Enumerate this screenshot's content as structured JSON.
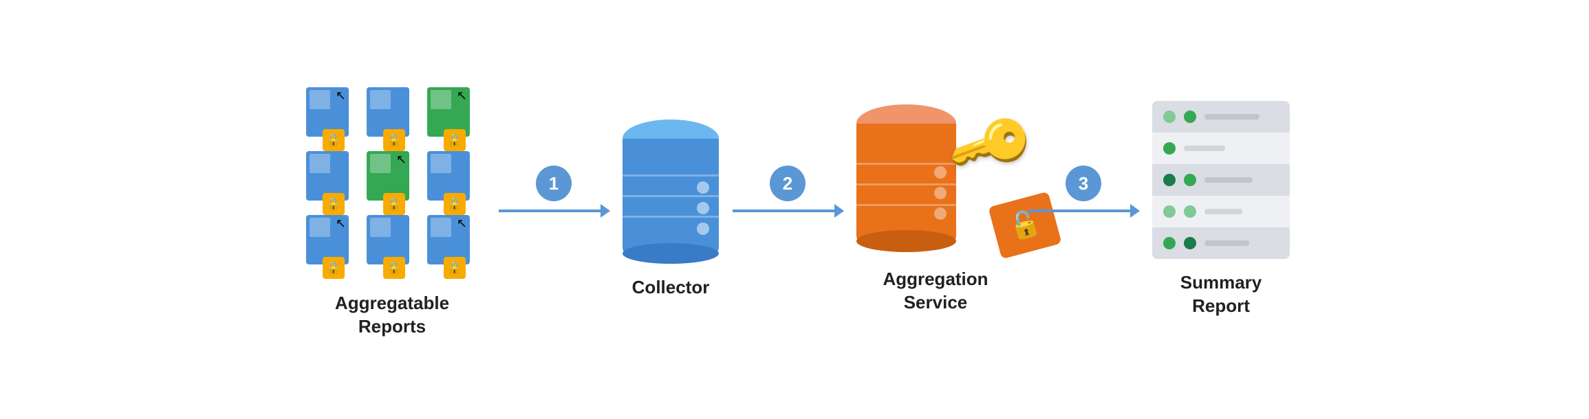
{
  "diagram": {
    "nodes": [
      {
        "id": "aggregatable-reports",
        "label": "Aggregatable\nReports"
      },
      {
        "id": "collector",
        "label": "Collector"
      },
      {
        "id": "aggregation-service",
        "label": "Aggregation\nService"
      },
      {
        "id": "summary-report",
        "label": "Summary\nReport"
      }
    ],
    "steps": [
      "1",
      "2",
      "3"
    ],
    "summary_rows": [
      {
        "dots": [
          "light",
          "mid",
          "light"
        ],
        "line_width": "80"
      },
      {
        "dots": [
          "mid"
        ],
        "line_width": "60"
      },
      {
        "dots": [
          "dark",
          "mid"
        ],
        "line_width": "70"
      },
      {
        "dots": [
          "light",
          "light",
          "mid"
        ],
        "line_width": "55"
      },
      {
        "dots": [
          "mid",
          "dark"
        ],
        "line_width": "65"
      }
    ]
  }
}
